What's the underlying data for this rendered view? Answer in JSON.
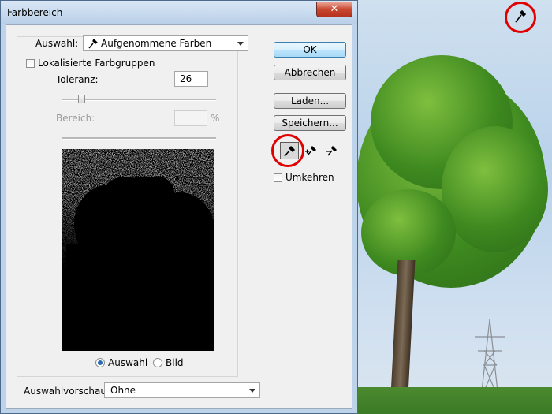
{
  "window": {
    "title": "Farbbereich",
    "close_label": "✕"
  },
  "selection": {
    "label": "Auswahl:",
    "value": "Aufgenommene Farben"
  },
  "localized": {
    "label": "Lokalisierte Farbgruppen",
    "checked": false
  },
  "tolerance": {
    "label": "Toleranz:",
    "value": "26",
    "slider_fraction": 0.13
  },
  "range": {
    "label": "Bereich:",
    "value": "",
    "unit": "%"
  },
  "preview_mode": {
    "options": [
      "Auswahl",
      "Bild"
    ],
    "selected": "Auswahl"
  },
  "preview_select": {
    "label": "Auswahlvorschau:",
    "value": "Ohne"
  },
  "buttons": {
    "ok": "OK",
    "cancel": "Abbrechen",
    "load": "Laden...",
    "save": "Speichern..."
  },
  "tools": [
    "eyedropper-icon",
    "eyedropper-plus-icon",
    "eyedropper-minus-icon"
  ],
  "invert": {
    "label": "Umkehren",
    "checked": false
  },
  "colors": {
    "highlight_circle": "#e10000",
    "default_button_border": "#3c7fb1"
  }
}
